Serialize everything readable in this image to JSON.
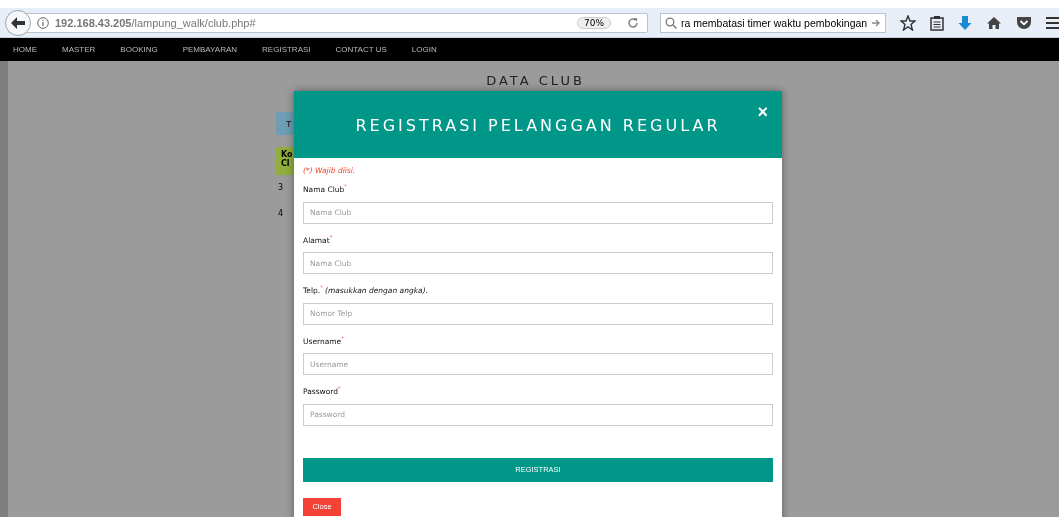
{
  "browser": {
    "url": "**192.168.43.205**/lampung_walk/club.php#",
    "zoom": "70%",
    "search_value": "ra membatasi timer waktu pembokingan"
  },
  "nav": {
    "items": [
      "HOME",
      "MASTER",
      "BOOKING",
      "PEMBAYARAN",
      "REGISTRASI",
      "CONTACT US",
      "LOGIN"
    ]
  },
  "page": {
    "title": "DATA CLUB",
    "button": "T",
    "table_header": [
      "Ko",
      "Cl"
    ],
    "rows": [
      "3",
      "4"
    ]
  },
  "modal": {
    "title": "REGISTRASI PELANGGAN REGULAR",
    "close_icon": "×",
    "note": "(*) Wajib diisi.",
    "fields": [
      {
        "label": "Nama Club$^{*}$",
        "placeholder": "Nama Club"
      },
      {
        "label": "Alamat$^{*}$",
        "placeholder": "Nama Club"
      },
      {
        "label": "Telp.$^{*}$ *(masukkan dengan angka).*",
        "placeholder": "Nomor Telp"
      },
      {
        "label": "Username$^{*}$",
        "placeholder": "Username"
      },
      {
        "label": "Password$^{*}$",
        "placeholder": "Password"
      }
    ],
    "submit": "REGISTRASI",
    "close": "Close"
  }
}
